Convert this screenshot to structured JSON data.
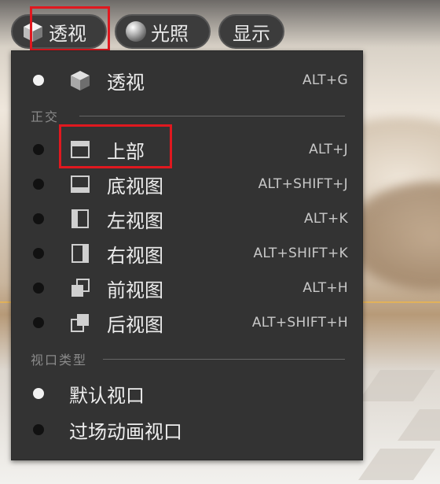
{
  "toolbar": {
    "perspective_label": "透视",
    "lighting_label": "光照",
    "show_label": "显示"
  },
  "menu": {
    "current": {
      "label": "透视",
      "shortcut": "ALT+G",
      "icon": "cube-icon",
      "selected": true
    },
    "ortho_header": "正交",
    "ortho_items": [
      {
        "label": "上部",
        "shortcut": "ALT+J",
        "icon": "view-top-icon"
      },
      {
        "label": "底视图",
        "shortcut": "ALT+SHIFT+J",
        "icon": "view-bottom-icon"
      },
      {
        "label": "左视图",
        "shortcut": "ALT+K",
        "icon": "view-left-icon"
      },
      {
        "label": "右视图",
        "shortcut": "ALT+SHIFT+K",
        "icon": "view-right-icon"
      },
      {
        "label": "前视图",
        "shortcut": "ALT+H",
        "icon": "view-front-icon"
      },
      {
        "label": "后视图",
        "shortcut": "ALT+SHIFT+H",
        "icon": "view-back-icon"
      }
    ],
    "viewport_header": "视口类型",
    "viewport_items": [
      {
        "label": "默认视口",
        "selected": true
      },
      {
        "label": "过场动画视口",
        "selected": false
      }
    ]
  },
  "colors": {
    "menu_bg": "#333333",
    "highlight": "#e0181f",
    "bullet_on": "#f2f2f2",
    "bullet_off": "#111111"
  }
}
